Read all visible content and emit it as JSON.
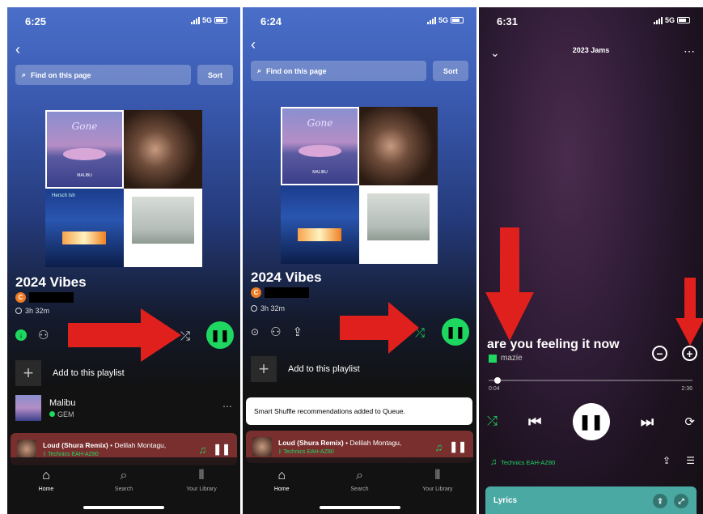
{
  "panel1": {
    "status": {
      "time": "6:25",
      "network": "5G"
    },
    "search_placeholder": "Find on this page",
    "sort_label": "Sort",
    "cover": {
      "top_left_title": "Gone",
      "top_left_caption": "MALIBU",
      "bottom_left_caption": "Hersch Ish"
    },
    "playlist_title": "2024 Vibes",
    "owner_initial": "C",
    "duration": "3h 32m",
    "add_label": "Add to this playlist",
    "track": {
      "title": "Malibu",
      "artist": "GEM"
    },
    "mini_player": {
      "song": "Loud (Shura Remix)",
      "artist": "Delilah Montagu,",
      "device": "Technics EAH-AZ80"
    },
    "nav": {
      "home": "Home",
      "search": "Search",
      "library": "Your Library"
    }
  },
  "panel2": {
    "status": {
      "time": "6:24",
      "network": "5G"
    },
    "search_placeholder": "Find on this page",
    "sort_label": "Sort",
    "cover": {
      "top_left_title": "Gone",
      "top_left_caption": "MALIBU"
    },
    "playlist_title": "2024 Vibes",
    "owner_initial": "C",
    "duration": "3h 32m",
    "add_label": "Add to this playlist",
    "toast": "Smart Shuffle recommendations added to Queue.",
    "mini_player": {
      "song": "Loud (Shura Remix)",
      "artist": "Delilah Montagu,",
      "device": "Technics EAH-AZ80"
    },
    "nav": {
      "home": "Home",
      "search": "Search",
      "library": "Your Library"
    }
  },
  "panel3": {
    "status": {
      "time": "6:31",
      "network": "5G"
    },
    "context_title": "2023 Jams",
    "song_title": "are you feeling it now",
    "artist": "mazie",
    "elapsed": "0:04",
    "total": "2:36",
    "progress_fraction": 0.026,
    "device": "Technics EAH-AZ80",
    "lyrics_label": "Lyrics"
  },
  "colors": {
    "accent": "#1ed760",
    "arrow": "#e0201c",
    "mini_player_bg": "#7a2f2f",
    "lyrics_bg": "#4aa9a3"
  },
  "icons": [
    "back-chevron-icon",
    "search-icon",
    "download-icon",
    "add-user-icon",
    "shuffle-icon",
    "smart-shuffle-icon",
    "share-icon",
    "pause-icon",
    "headphones-icon",
    "home-icon",
    "library-icon",
    "minus-circle-icon",
    "plus-circle-icon",
    "previous-icon",
    "next-icon",
    "repeat-icon",
    "queue-icon",
    "expand-icon"
  ]
}
